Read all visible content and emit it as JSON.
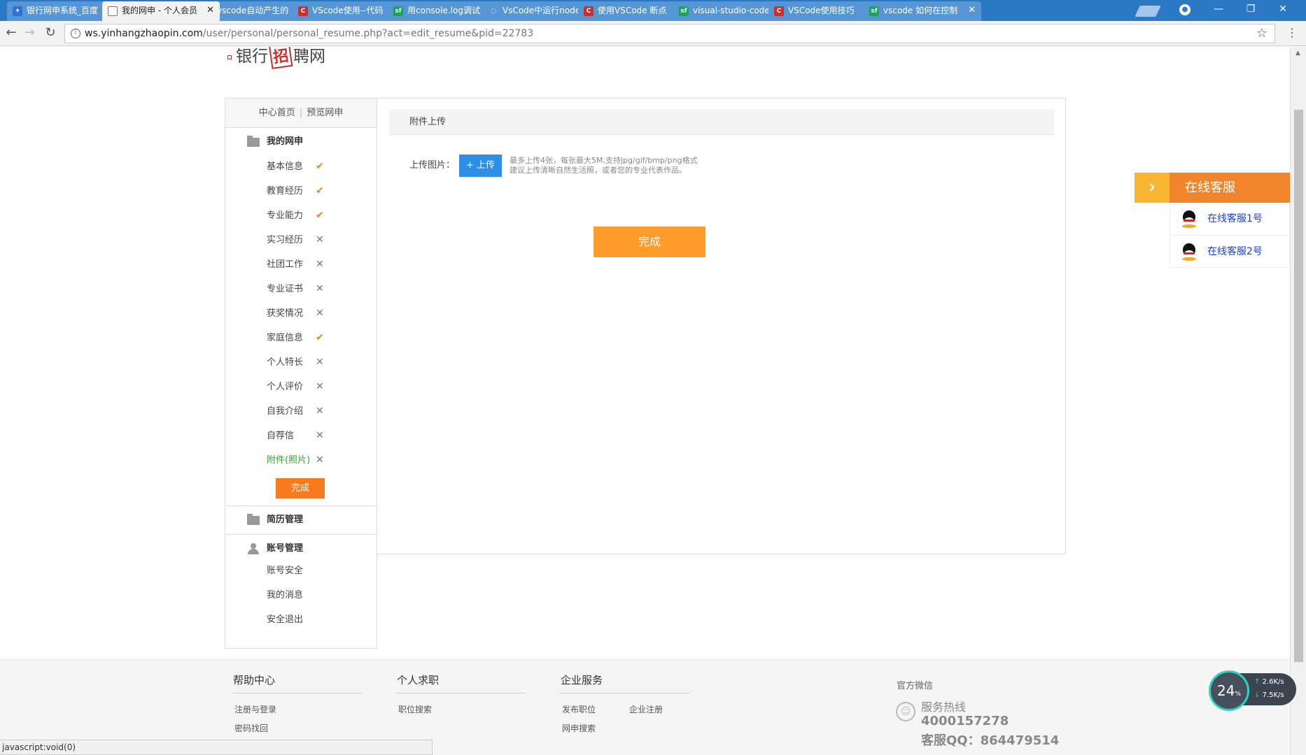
{
  "browser": {
    "tabs": [
      {
        "title": "银行网申系统_百度",
        "favicon": "paw-icon",
        "color": "#2f6fd6",
        "glyph": "✦",
        "active": false
      },
      {
        "title": "我的网申 - 个人会员",
        "favicon": "page-icon",
        "color": "#ffffff",
        "glyph": "",
        "active": true
      },
      {
        "title": "vscode自动产生的",
        "favicon": "loading-icon",
        "color": "#5796d4",
        "glyph": "◌",
        "active": false
      },
      {
        "title": "VScode使用--代码",
        "favicon": "csdn-icon",
        "color": "#c9302c",
        "glyph": "C",
        "active": false
      },
      {
        "title": "用console.log调试",
        "favicon": "sf-icon",
        "color": "#1ba35a",
        "glyph": "sf",
        "active": false
      },
      {
        "title": "VsCode中运行node",
        "favicon": "loading-icon",
        "color": "#5796d4",
        "glyph": "◌",
        "active": false
      },
      {
        "title": "使用VSCode 断点",
        "favicon": "csdn-icon",
        "color": "#c9302c",
        "glyph": "C",
        "active": false
      },
      {
        "title": "visual-studio-code",
        "favicon": "sf-icon",
        "color": "#1ba35a",
        "glyph": "sf",
        "active": false
      },
      {
        "title": "VSCode使用技巧",
        "favicon": "csdn-icon",
        "color": "#c9302c",
        "glyph": "C",
        "active": false
      },
      {
        "title": "vscode 如何在控制",
        "favicon": "sf-icon",
        "color": "#1ba35a",
        "glyph": "sf",
        "active": false
      }
    ],
    "url_host": "ws.yinhangzhaopin.com",
    "url_path": "/user/personal/personal_resume.php?act=edit_resume&pid=22783",
    "status_text": "javascript:void(0)"
  },
  "logo": {
    "text_left": "银行",
    "text_mark": "招",
    "text_right": "聘网"
  },
  "sidebar": {
    "top_links": {
      "home": "中心首页",
      "preview": "预览网申"
    },
    "group_mine": "我的网申",
    "items": [
      {
        "label": "基本信息",
        "status": "✔",
        "done": true
      },
      {
        "label": "教育经历",
        "status": "✔",
        "done": true
      },
      {
        "label": "专业能力",
        "status": "✔",
        "done": true
      },
      {
        "label": "实习经历",
        "status": "✕",
        "done": false
      },
      {
        "label": "社团工作",
        "status": "✕",
        "done": false
      },
      {
        "label": "专业证书",
        "status": "✕",
        "done": false
      },
      {
        "label": "获奖情况",
        "status": "✕",
        "done": false
      },
      {
        "label": "家庭信息",
        "status": "✔",
        "done": true
      },
      {
        "label": "个人特长",
        "status": "✕",
        "done": false
      },
      {
        "label": "个人评价",
        "status": "✕",
        "done": false
      },
      {
        "label": "自我介绍",
        "status": "✕",
        "done": false
      },
      {
        "label": "自荐信",
        "status": "✕",
        "done": false
      },
      {
        "label": "附件(照片)",
        "status": "✕",
        "done": false
      }
    ],
    "done_button": "完成",
    "group_resume": "简历管理",
    "group_account": "账号管理",
    "account_items": [
      "账号安全",
      "我的消息",
      "安全退出"
    ]
  },
  "main": {
    "panel_title": "附件上传",
    "upload_label": "上传图片：",
    "upload_button": "+ 上传",
    "hint_line1": "最多上传4张，每张最大5M,支持jpg/gif/bmp/png格式",
    "hint_line2": "建议上传清晰自然生活照，或者您的专业代表作品。",
    "finish_button": "完成"
  },
  "online_service": {
    "title": "在线客服",
    "agents": [
      "在线客服1号",
      "在线客服2号"
    ]
  },
  "footer": {
    "columns": [
      {
        "title": "帮助中心",
        "links": [
          "注册与登录",
          "密码找回"
        ]
      },
      {
        "title": "个人求职",
        "links": [
          "职位搜索"
        ]
      },
      {
        "title": "企业服务",
        "links": [
          "发布职位",
          "企业注册",
          "网申搜索"
        ]
      }
    ],
    "wechat_title": "官方微信",
    "hotline_label": "服务热线",
    "hotline_number": "4000157278",
    "qq_line": "客服QQ：864479514"
  },
  "speed_widget": {
    "percent": "24",
    "percent_unit": "%",
    "up": "2.6K/s",
    "down": "7.5K/s"
  },
  "colors": {
    "accent_orange": "#fe9a2a",
    "upload_blue": "#2d8fe8",
    "done_check": "#f28120",
    "current_green": "#3a9e36"
  }
}
